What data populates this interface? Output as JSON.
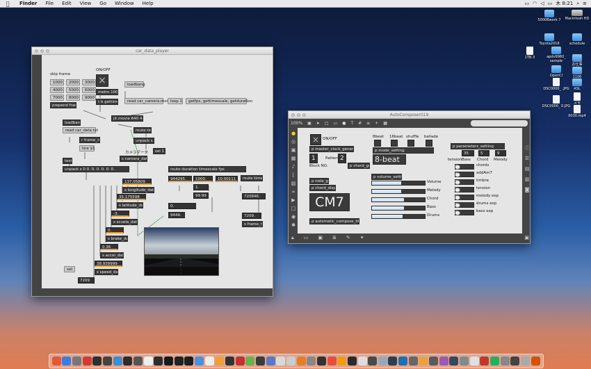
{
  "menubar": {
    "app": "Finder",
    "items": [
      "File",
      "Edit",
      "View",
      "Go",
      "Window",
      "Help"
    ],
    "clock": "木 8:21"
  },
  "desktop": {
    "icons": [
      {
        "label": "5000Bwork 7",
        "kind": "folder"
      },
      {
        "label": "Macintosh HD",
        "kind": "disk"
      },
      {
        "label": "Toyota2018",
        "kind": "folder"
      },
      {
        "label": "schedule",
        "kind": "folder"
      },
      {
        "label": "1TB-3",
        "kind": "doc"
      },
      {
        "label": "apdv9960_ sample",
        "kind": "folder"
      },
      {
        "label": "お仕事",
        "kind": "folder"
      },
      {
        "label": "OpenCI",
        "kind": "folder"
      },
      {
        "label": "1106",
        "kind": "folder"
      },
      {
        "label": "DSC0000_ .JPG",
        "kind": "doc"
      },
      {
        "label": "ASL",
        "kind": "folder"
      },
      {
        "label": "DSC0000_ 0.JPG",
        "kind": "doc"
      },
      {
        "label": "メモ",
        "kind": "doc"
      },
      {
        "label": "0030.mp4",
        "kind": "doc"
      }
    ]
  },
  "player": {
    "title": "car_data_player",
    "comments": {
      "skip": "skip frame",
      "onoff": "ON/OFF",
      "camera": "カメラデータ"
    },
    "grid": [
      "1000",
      "2000",
      "3000",
      "4000",
      "5000",
      "6000",
      "7000",
      "8000",
      "9000"
    ],
    "objects": {
      "prepend": "prepend frame",
      "metro": "metro 100",
      "tb": "t b gettime",
      "loadbang1": "loadbang",
      "readcam": "read car_camera.mov",
      "loop": "loop 1",
      "getfps": "getfps, gettimescale, getduration",
      "jit": "jit.movie 640 480",
      "loadbang2": "loadbang",
      "readtxt": "read car_data.txt",
      "rframe": "r frame_no",
      "line": "line $1",
      "text": "text",
      "unpack": "unpack s 0 0. 0. 0. 0. 0. 0.",
      "routeread": "route read",
      "unpacks0": "unpack s 0",
      "sel1": "sel 1",
      "scam": "s camera_data",
      "routedur": "route duration timescale fps",
      "routetime": "route time",
      "set": "set",
      "slong": "s longitude_data",
      "slat": "s latitude_data",
      "saccel": "s scuela_data",
      "sbrake": "s brake_data",
      "sacc": "s accel_data",
      "sspeed": "s speed_data",
      "sframe": "s frame_no"
    },
    "numbers": {
      "long": "137.05809",
      "lat": "35.175598",
      "scuela": "-3.",
      "brake": "0.",
      "accel": "0.36",
      "speed": "38.939999",
      "frame": "7209",
      "dur": "944295.",
      "ts": "1000.",
      "fps": "10.00111",
      "t1": "1.",
      "t99": "99.99",
      "t0": "0.",
      "t9444": "9444.",
      "rt": "720846.",
      "rt2": "7209."
    }
  },
  "composer": {
    "title": "AutoComposer019",
    "zoom": "100%",
    "search_placeholder": "",
    "labels": {
      "onoff": "ON/OFF",
      "block": "Block NO.",
      "pattern": "Pattern",
      "b8": "8beat",
      "b16": "16beat",
      "shuffle": "shuffle",
      "ballade": "ballade",
      "tension": "tension",
      "bass": "Bass",
      "chord": "Chord",
      "melody": "Melody"
    },
    "objects": {
      "master": "p master_clock_generator",
      "mode": "p mode_setting",
      "params": "p parameters_setting",
      "chordget": "p chord_get",
      "noteget": "p note_get",
      "chorddisp": "p chord_display",
      "volume": "p volume_setting",
      "auto": "p automatic_compose_blocks"
    },
    "values": {
      "block": "1",
      "pattern": "2",
      "mode": "8-beat",
      "chord": "CM7",
      "tension_bass": "35",
      "tension_chord": "5",
      "tension_melody": "9"
    },
    "volumes": [
      {
        "name": "Volume",
        "level": 0.55
      },
      {
        "name": "Melody",
        "level": 0.55
      },
      {
        "name": "Chord",
        "level": 0.6
      },
      {
        "name": "Bass",
        "level": 0.6
      },
      {
        "name": "Drums",
        "level": 0.58
      }
    ],
    "param_rows": [
      {
        "name": "chords",
        "level": 0.12
      },
      {
        "name": "addAm7",
        "level": 0.12
      },
      {
        "name": "timbre",
        "level": 0.12
      },
      {
        "name": "tension",
        "level": 0.12
      },
      {
        "name": "melody exp",
        "level": 0.12
      },
      {
        "name": "drums exp",
        "level": 0.12
      },
      {
        "name": "bass exp",
        "level": 0.12
      }
    ]
  }
}
